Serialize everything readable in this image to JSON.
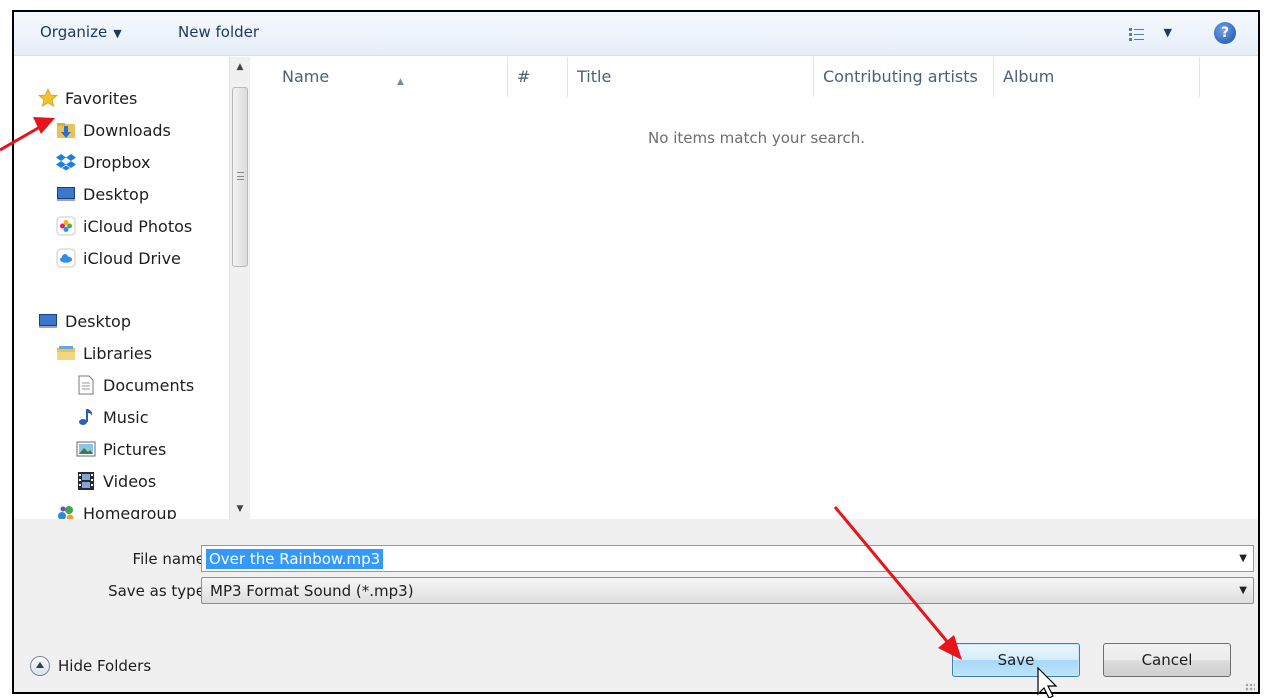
{
  "toolbar": {
    "organize_label": "Organize",
    "new_folder_label": "New folder",
    "view_icon": "view-list-icon",
    "help_icon": "help-icon",
    "help_glyph": "?"
  },
  "nav": {
    "favorites_label": "Favorites",
    "favorites": [
      {
        "label": "Downloads",
        "icon": "downloads-folder-icon"
      },
      {
        "label": "Dropbox",
        "icon": "dropbox-icon"
      },
      {
        "label": "Desktop",
        "icon": "desktop-icon"
      },
      {
        "label": "iCloud Photos",
        "icon": "icloud-photos-icon"
      },
      {
        "label": "iCloud Drive",
        "icon": "icloud-drive-icon"
      }
    ],
    "desktop_label": "Desktop",
    "libraries_label": "Libraries",
    "libraries": [
      {
        "label": "Documents",
        "icon": "documents-icon"
      },
      {
        "label": "Music",
        "icon": "music-icon"
      },
      {
        "label": "Pictures",
        "icon": "pictures-icon"
      },
      {
        "label": "Videos",
        "icon": "videos-icon"
      }
    ],
    "homegroup_label": "Homegroup"
  },
  "columns": [
    "Name",
    "#",
    "Title",
    "Contributing artists",
    "Album"
  ],
  "empty_message": "No items match your search.",
  "form": {
    "file_name_label": "File name:",
    "file_name_value": "Over the Rainbow.mp3",
    "save_type_label": "Save as type:",
    "save_type_value": "MP3 Format Sound (*.mp3)"
  },
  "footer": {
    "hide_folders_label": "Hide Folders",
    "save_label": "Save",
    "cancel_label": "Cancel"
  },
  "annotations": {
    "arrow_color": "#e8141b"
  }
}
